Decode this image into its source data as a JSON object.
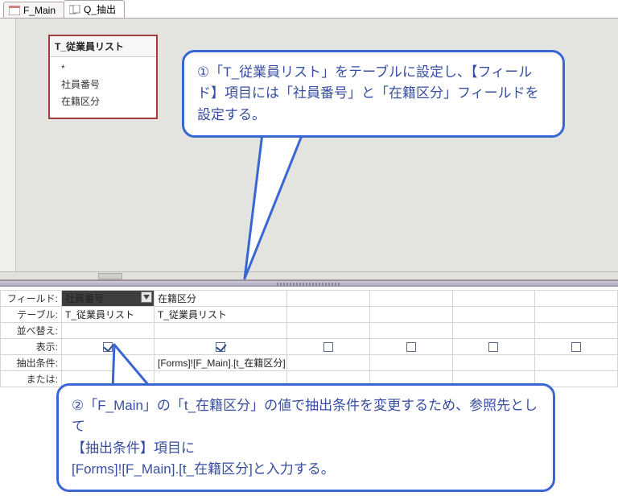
{
  "tabs": [
    {
      "label": "F_Main",
      "icon": "form-icon"
    },
    {
      "label": "Q_抽出",
      "icon": "query-icon"
    }
  ],
  "table_box": {
    "title": "T_従業員リスト",
    "fields": [
      "*",
      "社員番号",
      "在籍区分"
    ]
  },
  "grid": {
    "row_labels": {
      "field": "フィールド:",
      "table": "テーブル:",
      "sort": "並べ替え:",
      "show": "表示:",
      "criteria": "抽出条件:",
      "or": "または:"
    },
    "cols": [
      {
        "field": "社員番号",
        "table": "T_従業員リスト",
        "show": true,
        "criteria": ""
      },
      {
        "field": "在籍区分",
        "table": "T_従業員リスト",
        "show": true,
        "criteria": "[Forms]![F_Main].[t_在籍区分]"
      }
    ]
  },
  "callouts": {
    "c1": "①「T_従業員リスト」をテーブルに設定し、【フィールド】項目には「社員番号」と「在籍区分」フィールドを設定する。",
    "c2": "②「F_Main」の「t_在籍区分」の値で抽出条件を変更するため、参照先として\n【抽出条件】項目に\n[Forms]![F_Main].[t_在籍区分]と入力する。"
  }
}
